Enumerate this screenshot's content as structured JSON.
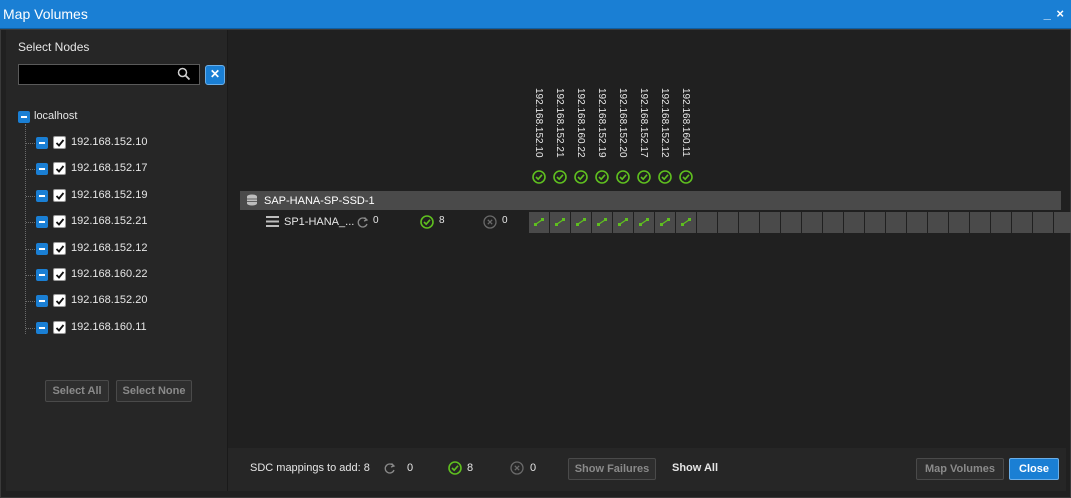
{
  "window": {
    "title": "Map Volumes",
    "controls": "_ ×"
  },
  "left_panel": {
    "heading": "Select Nodes",
    "search": {
      "value": "",
      "placeholder": ""
    },
    "tree": {
      "root": "localhost",
      "nodes": [
        {
          "label": "192.168.152.10",
          "checked": true
        },
        {
          "label": "192.168.152.17",
          "checked": true
        },
        {
          "label": "192.168.152.19",
          "checked": true
        },
        {
          "label": "192.168.152.21",
          "checked": true
        },
        {
          "label": "192.168.152.12",
          "checked": true
        },
        {
          "label": "192.168.160.22",
          "checked": true
        },
        {
          "label": "192.168.152.20",
          "checked": true
        },
        {
          "label": "192.168.160.11",
          "checked": true
        }
      ]
    },
    "select_all": "Select All",
    "select_none": "Select None"
  },
  "matrix": {
    "columns": [
      "192.168.152.10",
      "192.168.152.21",
      "192.168.160.22",
      "192.168.152.19",
      "192.168.152.20",
      "192.168.152.17",
      "192.168.152.12",
      "192.168.160.11"
    ],
    "group": "SAP-HANA-SP-SSD-1",
    "pool": {
      "name": "SP1-HANA_...",
      "pending": "0",
      "success": "8",
      "failed": "0"
    }
  },
  "footer": {
    "label": "SDC mappings to add: 8",
    "pending": "0",
    "success": "8",
    "failed": "0",
    "show_failures": "Show Failures",
    "show_all": "Show All",
    "map_volumes": "Map Volumes",
    "close": "Close"
  },
  "colors": {
    "accent": "#1a7fd4",
    "success": "#5fbf1f",
    "background": "#202020"
  }
}
